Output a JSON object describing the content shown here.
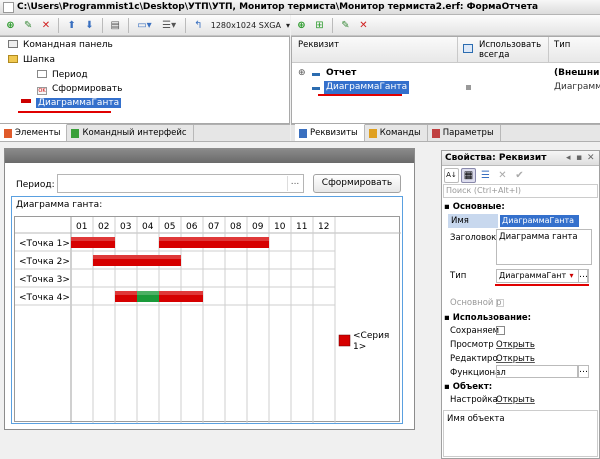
{
  "window": {
    "title": "C:\\Users\\Programmist1c\\Desktop\\УТП\\УТП, Монитор термиста\\Монитор термиста2.erf: ФормаОтчета"
  },
  "toolbar": {
    "resolution": "1280x1024 SXGA"
  },
  "elements_tree": {
    "items": [
      {
        "label": "Командная панель",
        "icon": "command-panel-icon",
        "level": 0
      },
      {
        "label": "Шапка",
        "icon": "folder-icon",
        "level": 0
      },
      {
        "label": "Период",
        "icon": "field-icon",
        "level": 1
      },
      {
        "label": "Сформировать",
        "icon": "ok-button-icon",
        "level": 1
      },
      {
        "label": "ДиаграммаГанта",
        "icon": "gantt-chart-icon",
        "level": 0,
        "selected": true
      }
    ],
    "tabs": [
      {
        "label": "Элементы"
      },
      {
        "label": "Командный интерфейс"
      }
    ]
  },
  "requisites": {
    "columns": {
      "name": "Реквизит",
      "use_always": "Использовать всегда",
      "type": "Тип"
    },
    "rows": [
      {
        "name": "Отчет",
        "type": "(Внешний)",
        "bold": true
      },
      {
        "name": "ДиаграммаГанта",
        "type": "Диаграмм",
        "selected": true
      }
    ],
    "tabs": [
      {
        "label": "Реквизиты"
      },
      {
        "label": "Команды"
      },
      {
        "label": "Параметры"
      }
    ]
  },
  "form": {
    "period_label": "Период:",
    "period_value": "",
    "period_btn": "...",
    "generate_button": "Сформировать",
    "gantt_title": "Диаграмма ганта:",
    "gantt": {
      "columns": [
        "01",
        "02",
        "03",
        "04",
        "05",
        "06",
        "07",
        "08",
        "09",
        "10",
        "11",
        "12"
      ],
      "rows": [
        {
          "label": "<Точка 1>",
          "bars": [
            {
              "start": 0,
              "end": 2,
              "color": "#d60000"
            },
            {
              "start": 4,
              "end": 9,
              "color": "#d60000"
            }
          ]
        },
        {
          "label": "<Точка 2>",
          "bars": [
            {
              "start": 1,
              "end": 5,
              "color": "#d60000"
            }
          ]
        },
        {
          "label": "<Точка 3>",
          "bars": []
        },
        {
          "label": "<Точка 4>",
          "bars": [
            {
              "start": 2,
              "end": 3,
              "color": "#d60000"
            },
            {
              "start": 3,
              "end": 4,
              "color": "#1a9a3a"
            },
            {
              "start": 4,
              "end": 6,
              "color": "#d60000"
            }
          ]
        }
      ],
      "legend": {
        "label": "<Серия 1>",
        "color": "#d60000"
      }
    }
  },
  "properties": {
    "title": "Свойства: Реквизит",
    "search_placeholder": "Поиск (Ctrl+Alt+I)",
    "sections": {
      "basic": "Основные:",
      "usage": "Использование:",
      "object": "Объект:"
    },
    "name_label": "Имя",
    "name_value": "ДиаграммаГанта",
    "caption_label": "Заголовок",
    "caption_value": "Диаграмма ганта",
    "type_label": "Тип",
    "type_value": "ДиаграммаГант",
    "main_label": "Основной р",
    "saved_label": "Сохраняем",
    "view_label": "Просмотр",
    "view_link": "Открыть",
    "edit_label": "Редактиро",
    "edit_link": "Открыть",
    "func_label": "Функционал",
    "settings_label": "Настройка",
    "settings_link": "Открыть",
    "description": "Имя объекта"
  }
}
